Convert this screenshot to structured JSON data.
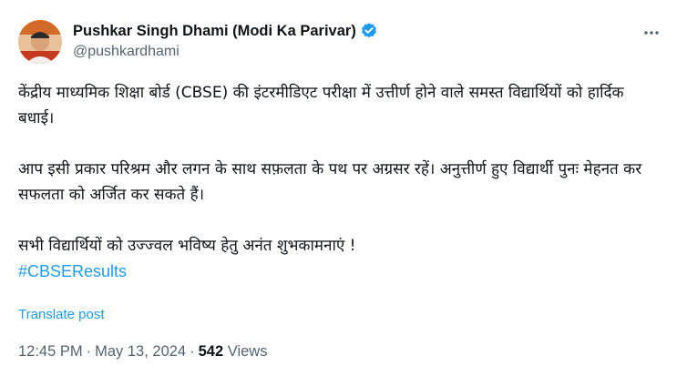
{
  "author": {
    "display_name": "Pushkar Singh Dhami (Modi Ka Parivar)",
    "handle": "@pushkardhami",
    "verified": true
  },
  "post": {
    "paragraphs": [
      "केंद्रीय माध्यमिक शिक्षा बोर्ड (CBSE) की इंटरमीडिएट परीक्षा में उत्तीर्ण होने वाले समस्त विद्यार्थियों को हार्दिक बधाई।",
      "आप इसी प्रकार परिश्रम और लगन के साथ सफ़लता के पथ पर अग्रसर रहें। अनुत्तीर्ण हुए विद्यार्थी पुनः मेहनत कर सफलता को अर्जित कर सकते हैं।",
      "सभी विद्यार्थियों को उज्ज्वल भविष्य हेतु अनंत शुभकामनाएं !"
    ],
    "hashtag": "#CBSEResults",
    "translate_label": "Translate post"
  },
  "meta": {
    "time": "12:45 PM",
    "separator": "·",
    "date": "May 13, 2024",
    "views_count": "542",
    "views_label": "Views"
  },
  "colors": {
    "link_blue": "#1d9bf0",
    "secondary_text": "#536471",
    "primary_text": "#0f1419"
  },
  "icons": {
    "verified": "verified-badge-icon",
    "more": "more-options-icon",
    "avatar": "profile-avatar"
  }
}
